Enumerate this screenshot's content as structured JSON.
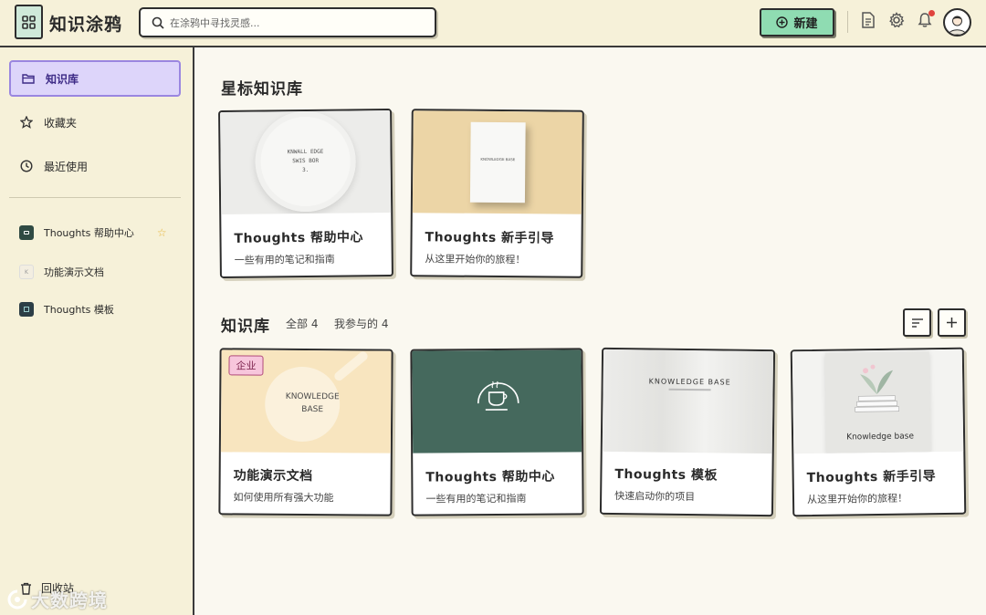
{
  "app": {
    "title": "知识涂鸦"
  },
  "search": {
    "placeholder": "在涂鸦中寻找灵感..."
  },
  "header": {
    "new_label": "新建"
  },
  "icons": {
    "logo": "grid-icon",
    "search": "search-icon",
    "new": "plus-circle-icon",
    "doc": "document-icon",
    "settings": "gear-icon",
    "notifications": "bell-icon",
    "avatar": "user-avatar",
    "trash": "trash-icon"
  },
  "colors": {
    "accent_green": "#8fdcb2",
    "active_purple": "#ddd5fa",
    "badge_pink": "#f7c6dc",
    "star": "#e8b53a"
  },
  "sidebar": {
    "nav": [
      {
        "label": "知识库",
        "icon": "folder-icon",
        "active": true
      },
      {
        "label": "收藏夹",
        "icon": "star-icon",
        "active": false
      },
      {
        "label": "最近使用",
        "icon": "clock-icon",
        "active": false
      }
    ],
    "kbs": [
      {
        "label": "Thoughts 帮助中心",
        "starred": true
      },
      {
        "label": "功能演示文档",
        "starred": false
      },
      {
        "label": "Thoughts 模板",
        "starred": false
      }
    ],
    "trash_label": "回收站"
  },
  "starred_section": {
    "title": "星标知识库",
    "cards": [
      {
        "title": "Thoughts 帮助中心",
        "desc": "一些有用的笔记和指南",
        "cover_text": [
          "KNWALL EDGE",
          "SWIS BOR",
          "3."
        ]
      },
      {
        "title": "Thoughts 新手引导",
        "desc": "从这里开始你的旅程！",
        "cover_text": [
          "KNOWLEDGE BASE"
        ]
      }
    ]
  },
  "kb_section": {
    "title": "知识库",
    "filters": [
      {
        "label": "全部 4"
      },
      {
        "label": "我参与的 4"
      }
    ],
    "cards": [
      {
        "title": "功能演示文档",
        "desc": "如何使用所有强大功能",
        "badge": "企业",
        "cover_text": [
          "KNOWLEDGE",
          "BASE"
        ]
      },
      {
        "title": "Thoughts 帮助中心",
        "desc": "一些有用的笔记和指南"
      },
      {
        "title": "Thoughts 模板",
        "desc": "快速启动你的项目",
        "cover_text": [
          "KNOWLEDGE BASE"
        ]
      },
      {
        "title": "Thoughts 新手引导",
        "desc": "从这里开始你的旅程！",
        "cover_text": [
          "Knowledge base"
        ]
      }
    ]
  },
  "watermark": "大数跨境"
}
